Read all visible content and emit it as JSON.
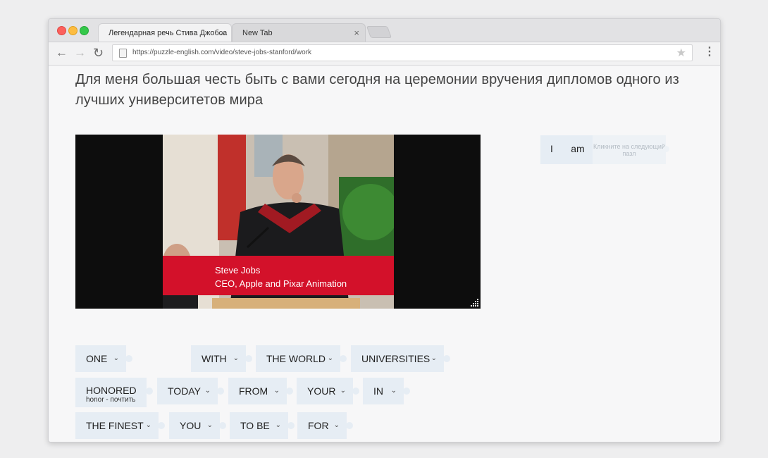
{
  "browser": {
    "tabs": [
      {
        "label": "Легендарная речь Стива Джобса",
        "close": "×",
        "active": true
      },
      {
        "label": "New Tab",
        "close": "×",
        "active": false
      }
    ],
    "url": "https://puzzle-english.com/video/steve-jobs-stanford/work",
    "nav": {
      "back": "←",
      "forward": "→",
      "reload": "↻",
      "star": "★",
      "menu": "⋮"
    }
  },
  "lesson": {
    "sentence": "Для меня большая честь быть с вами сегодня на церемонии вручения дипломов одного из лучших университетов мира"
  },
  "video": {
    "caption_name": "Steve Jobs",
    "caption_title": "CEO, Apple and Pixar Animation"
  },
  "answer": {
    "words": [
      "I",
      "am"
    ],
    "hint": "Кликните на следующий пазл"
  },
  "pieces": {
    "rows": [
      [
        {
          "label": "ONE",
          "chevron": "⌄"
        },
        {
          "label": "WITH",
          "chevron": "⌄"
        },
        {
          "label": "THE WORLD",
          "chevron": "⌄"
        },
        {
          "label": "UNIVERSITIES",
          "chevron": "⌄"
        }
      ],
      [
        {
          "label": "HONORED",
          "sub": "honor - почтить"
        },
        {
          "label": "TODAY",
          "chevron": "⌄"
        },
        {
          "label": "FROM",
          "chevron": "⌄"
        },
        {
          "label": "YOUR",
          "chevron": "⌄"
        },
        {
          "label": "IN",
          "chevron": "⌄"
        }
      ],
      [
        {
          "label": "THE FINEST",
          "chevron": "⌄"
        },
        {
          "label": "YOU",
          "chevron": "⌄"
        },
        {
          "label": "TO BE",
          "chevron": "⌄"
        },
        {
          "label": "FOR",
          "chevron": "⌄"
        }
      ]
    ]
  },
  "colors": {
    "piece_bg": "#e6edf4",
    "text": "#444444",
    "caption_red": "#d3112a"
  }
}
